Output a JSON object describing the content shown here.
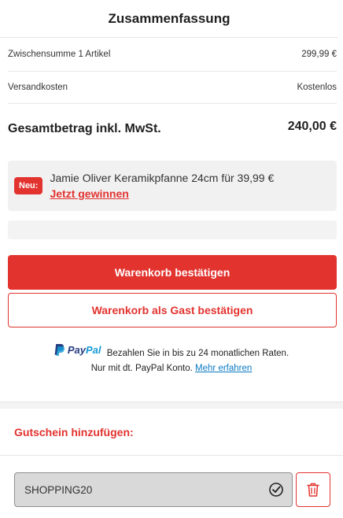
{
  "summary": {
    "title": "Zusammenfassung",
    "subtotal_label": "Zwischensumme 1 Artikel",
    "subtotal_value": "299,99 €",
    "shipping_label": "Versandkosten",
    "shipping_value": "Kostenlos",
    "total_label": "Gesamtbetrag inkl. MwSt.",
    "total_value": "240,00 €"
  },
  "promo": {
    "badge": "Neu:",
    "text": "Jamie Oliver Keramikpfanne 24cm für 39,99 €",
    "link": "Jetzt gewinnen"
  },
  "buttons": {
    "confirm": "Warenkorb bestätigen",
    "guest": "Warenkorb als Gast bestätigen"
  },
  "paypal": {
    "logo_pay": "Pay",
    "logo_pal": "Pal",
    "line1": "Bezahlen Sie in bis zu 24 monatlichen Raten.",
    "line2": "Nur mit dt. PayPal Konto.",
    "link": "Mehr erfahren"
  },
  "coupon": {
    "title": "Gutschein hinzufügen:",
    "value": "SHOPPING20",
    "check_icon": "check-circle-icon",
    "delete_icon": "trash-icon"
  },
  "colors": {
    "accent": "#e2332f",
    "paypal_dark": "#253b80",
    "paypal_light": "#179bd7"
  }
}
